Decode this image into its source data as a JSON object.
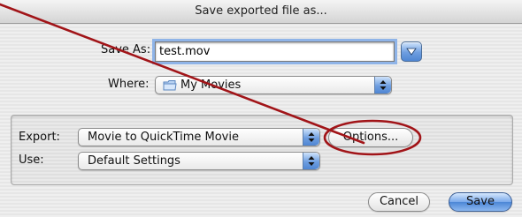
{
  "window": {
    "title": "Save exported file as..."
  },
  "save_as": {
    "label": "Save As:",
    "value": "test.mov"
  },
  "where": {
    "label": "Where:",
    "value": "My Movies"
  },
  "export": {
    "label": "Export:",
    "value": "Movie to QuickTime Movie"
  },
  "use": {
    "label": "Use:",
    "value": "Default Settings"
  },
  "options_button": {
    "label": "Options..."
  },
  "cancel_button": {
    "label": "Cancel"
  },
  "save_button": {
    "label": "Save"
  },
  "annotation": {
    "color": "#a11418"
  },
  "icons": {
    "disclosure": "chevron-down-icon",
    "popup": "up-down-arrows-icon",
    "folder": "folder-icon"
  }
}
